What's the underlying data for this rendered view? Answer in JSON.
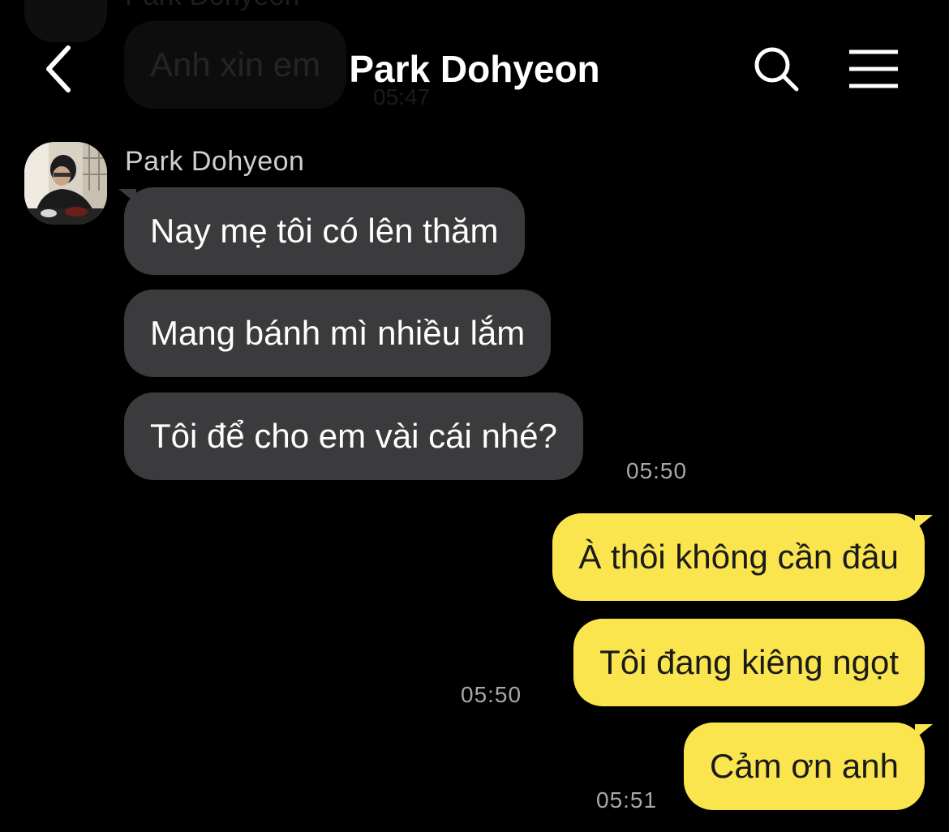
{
  "ghost": {
    "sender": "Park Dohyeon",
    "message": "Anh xin em",
    "time": "05:47"
  },
  "header": {
    "title": "Park Dohyeon",
    "back_icon": "chevron-left-icon",
    "search_icon": "search-icon",
    "menu_icon": "hamburger-menu-icon"
  },
  "incoming": {
    "sender": "Park Dohyeon",
    "messages": [
      "Nay mẹ tôi có lên thăm",
      "Mang bánh mì nhiều lắm",
      "Tôi để cho em vài cái nhé?"
    ],
    "time": "05:50"
  },
  "outgoing": [
    {
      "messages": [
        "À thôi không cần đâu",
        "Tôi đang kiêng ngọt"
      ],
      "time": "05:50"
    },
    {
      "messages": [
        "Cảm ơn anh"
      ],
      "time": "05:51"
    }
  ],
  "colors": {
    "background": "#000000",
    "incoming_bubble": "#3b3b3d",
    "outgoing_bubble": "#fae54e",
    "timestamp": "#a8a8a8"
  }
}
